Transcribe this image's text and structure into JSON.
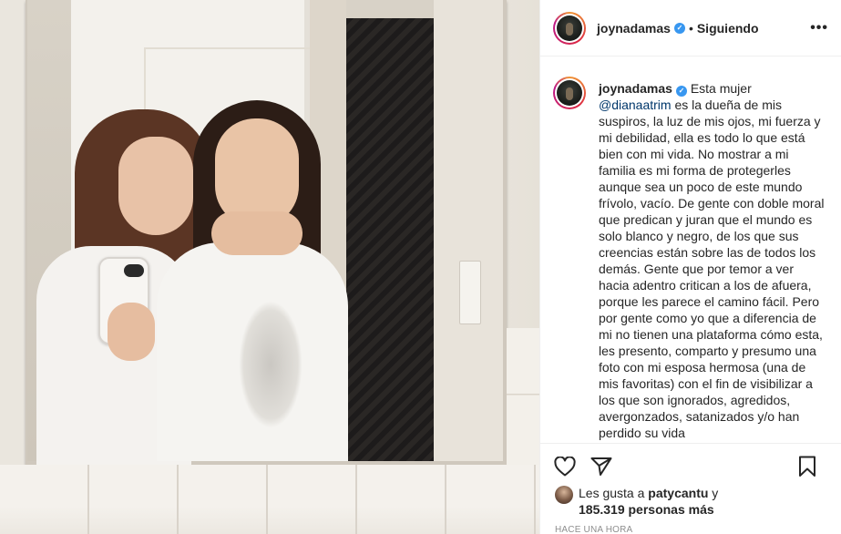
{
  "post": {
    "username": "joynadamas",
    "follow_separator": "•",
    "follow_status": "Siguiendo",
    "more_label": "•••",
    "caption_username": "joynadamas",
    "caption_intro": "Esta mujer",
    "caption_mention": "@dianaatrim",
    "caption_body": " es la dueña de mis suspiros, la luz de mis ojos, mi fuerza y mi debilidad, ella es todo lo que está bien con mi vida. No mostrar a mi familia es mi forma de protegerles aunque sea un poco de este mundo frívolo, vacío. De gente con doble moral que predican y juran que el mundo es solo blanco y negro, de los que sus creencias están sobre las de todos los demás. Gente que por temor a ver hacia adentro critican a los de afuera, porque les parece el camino fácil. Pero por gente como yo que a diferencia de mi no tienen una plataforma cómo esta, les presento, comparto y presumo una foto con mi esposa hermosa (una de mis favoritas) con el fin de visibilizar a los que son ignorados, agredidos, avergonzados, satanizados y/o han perdido su vida",
    "likes_prefix": "Les gusta a ",
    "likes_user": "patycantu",
    "likes_mid": " y",
    "likes_count": "185.319 personas más",
    "timestamp": "HACE UNA HORA"
  },
  "icons": {
    "verified": "verified-badge-icon",
    "like": "heart-icon",
    "share": "paper-plane-icon",
    "save": "bookmark-icon",
    "more": "more-options-icon"
  },
  "colors": {
    "verified": "#3897f0",
    "mention": "#00376b",
    "text": "#262626",
    "muted": "#8e8e8e"
  }
}
